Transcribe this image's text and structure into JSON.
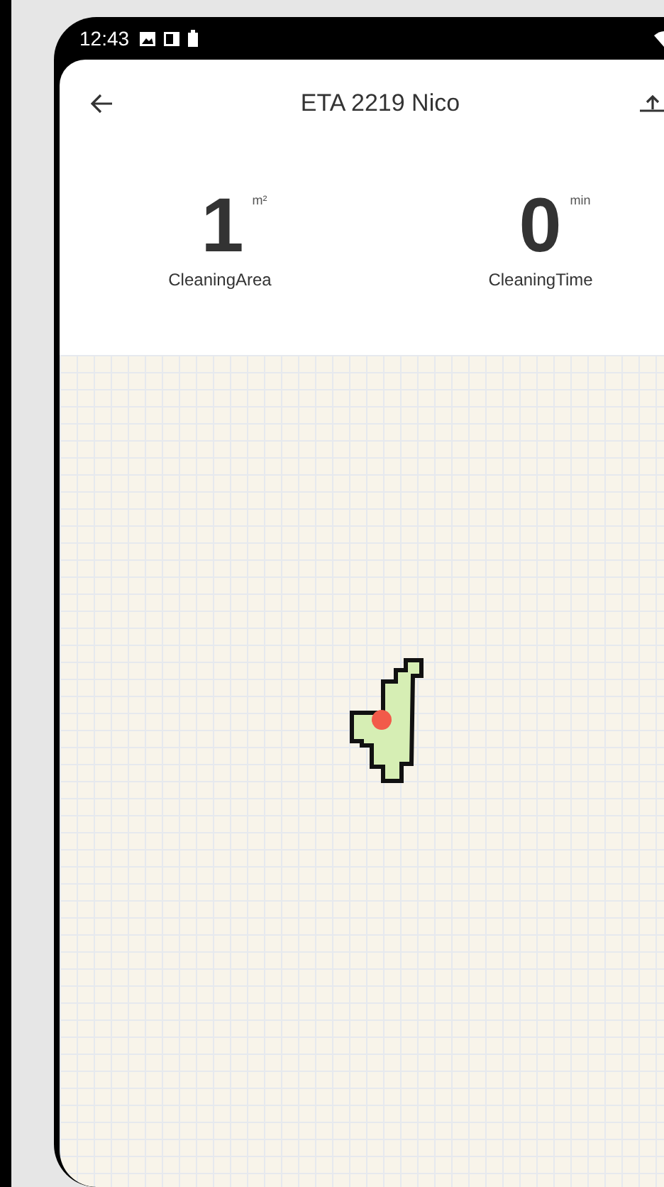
{
  "status_bar": {
    "time": "12:43"
  },
  "header": {
    "title": "ETA 2219 Nico"
  },
  "stats": [
    {
      "value": "1",
      "unit": "m²",
      "label": "CleaningArea"
    },
    {
      "value": "0",
      "unit": "min",
      "label": "CleaningTime"
    }
  ]
}
